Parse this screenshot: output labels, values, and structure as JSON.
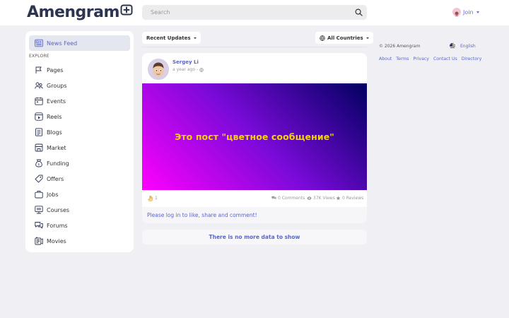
{
  "header": {
    "logo_text": "Amengram",
    "search_placeholder": "Search",
    "join_label": "Join"
  },
  "sidebar": {
    "news_feed": "News Feed",
    "explore_label": "EXPLORE",
    "items": [
      {
        "label": "Pages",
        "icon": "flag-icon"
      },
      {
        "label": "Groups",
        "icon": "people-icon"
      },
      {
        "label": "Events",
        "icon": "calendar-icon"
      },
      {
        "label": "Reels",
        "icon": "play-icon"
      },
      {
        "label": "Blogs",
        "icon": "document-icon"
      },
      {
        "label": "Market",
        "icon": "store-icon"
      },
      {
        "label": "Funding",
        "icon": "money-bag-icon"
      },
      {
        "label": "Offers",
        "icon": "tag-icon"
      },
      {
        "label": "Jobs",
        "icon": "briefcase-icon"
      },
      {
        "label": "Courses",
        "icon": "courses-icon"
      },
      {
        "label": "Forums",
        "icon": "forum-icon"
      },
      {
        "label": "Movies",
        "icon": "movie-icon"
      }
    ]
  },
  "feed": {
    "sort_label": "Recent Updates",
    "country_label": "All Countries",
    "post": {
      "author": "Sergey Li",
      "time": "a year ago",
      "separator": "-",
      "banner_text": "Это пост \"цветное сообщение\"",
      "reactions": "1",
      "comments": "0 Comments",
      "views": "37K Views",
      "reviews": "0 Reviews",
      "login_prompt": "Please log in to like, share and comment!"
    },
    "no_more": "There is no more data to show"
  },
  "footer": {
    "copyright": "© 2026 Amengram",
    "language": "English",
    "links": [
      "About",
      "Terms",
      "Privacy",
      "Contact Us",
      "Directory"
    ]
  },
  "colors": {
    "accent": "#5a66c9",
    "banner_text": "#f5d400",
    "background": "#f0f0f4"
  }
}
